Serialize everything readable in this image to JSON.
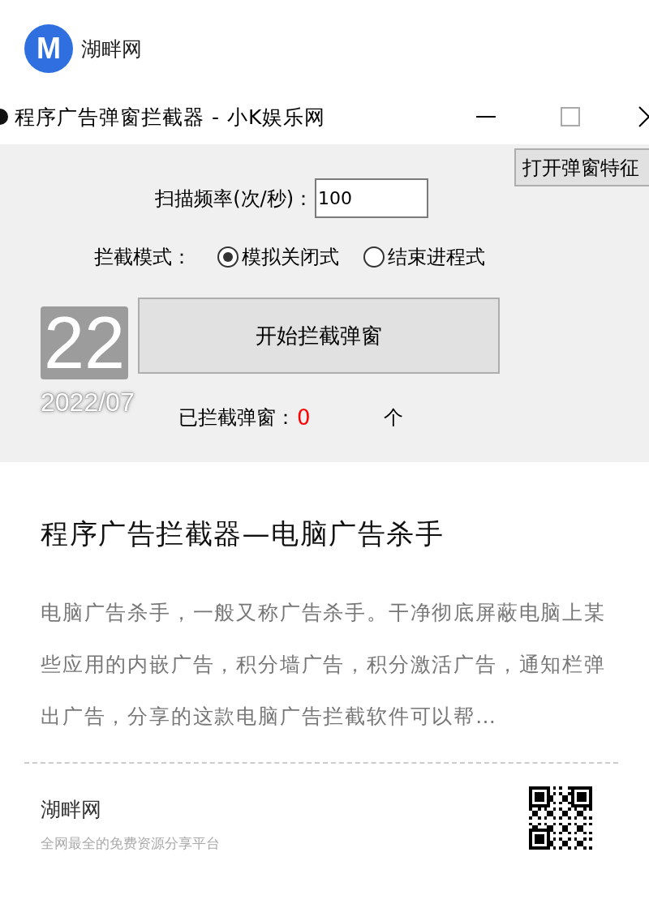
{
  "header": {
    "avatar_letter": "M",
    "site_name": "湖畔网"
  },
  "screenshot": {
    "window_title": "程序广告弹窗拦截器 - 小K娱乐网",
    "feature_button": "打开弹窗特征",
    "scan_label": "扫描频率(次/秒)：",
    "scan_value": "100",
    "mode_label": "拦截模式：",
    "modes": [
      {
        "label": "模拟关闭式",
        "selected": true
      },
      {
        "label": "结束进程式",
        "selected": false
      }
    ],
    "start_button": "开始拦截弹窗",
    "count_label": "已拦截弹窗：",
    "count": "0",
    "count_unit": "个",
    "date_day": "22",
    "date_month": "2022/07"
  },
  "article": {
    "title": "程序广告拦截器—电脑广告杀手",
    "summary": "电脑广告杀手，一般又称广告杀手。干净彻底屏蔽电脑上某些应用的内嵌广告，积分墙广告，积分激活广告，通知栏弹出广告，分享的这款电脑广告拦截软件可以帮…"
  },
  "footer": {
    "site_name": "湖畔网",
    "tagline": "全网最全的免费资源分享平台"
  }
}
